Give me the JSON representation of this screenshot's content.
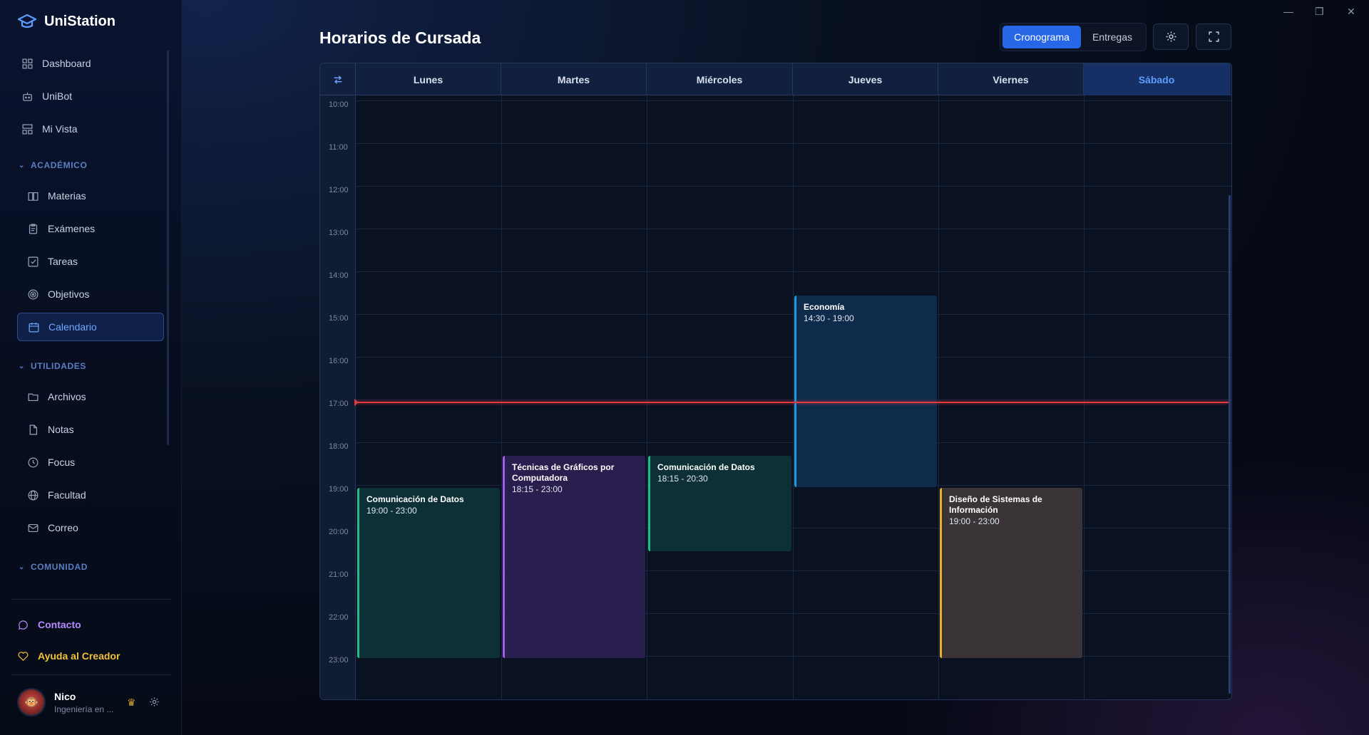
{
  "app": {
    "name": "UniStation"
  },
  "sidebar": {
    "top_items": [
      {
        "label": "Dashboard",
        "icon": "dashboard-icon"
      },
      {
        "label": "UniBot",
        "icon": "bot-icon"
      },
      {
        "label": "Mi Vista",
        "icon": "layout-icon"
      }
    ],
    "sections": {
      "academico": {
        "title": "ACADÉMICO",
        "items": [
          {
            "label": "Materias",
            "icon": "book-icon"
          },
          {
            "label": "Exámenes",
            "icon": "clipboard-icon"
          },
          {
            "label": "Tareas",
            "icon": "checkbox-icon"
          },
          {
            "label": "Objetivos",
            "icon": "target-icon"
          },
          {
            "label": "Calendario",
            "icon": "calendar-icon",
            "active": true
          }
        ]
      },
      "utilidades": {
        "title": "UTILIDADES",
        "items": [
          {
            "label": "Archivos",
            "icon": "folder-icon"
          },
          {
            "label": "Notas",
            "icon": "note-icon"
          },
          {
            "label": "Focus",
            "icon": "clock-icon"
          },
          {
            "label": "Facultad",
            "icon": "globe-icon"
          },
          {
            "label": "Correo",
            "icon": "mail-icon"
          }
        ]
      },
      "comunidad": {
        "title": "COMUNIDAD"
      }
    },
    "bottom": {
      "contact": "Contacto",
      "help": "Ayuda al Creador"
    },
    "user": {
      "name": "Nico",
      "subtitle": "Ingeniería en ..."
    }
  },
  "header": {
    "title": "Horarios de Cursada",
    "tabs": [
      "Cronograma",
      "Entregas"
    ],
    "active_tab": "Cronograma"
  },
  "calendar": {
    "days": [
      "Lunes",
      "Martes",
      "Miércoles",
      "Jueves",
      "Viernes",
      "Sábado"
    ],
    "today": "Sábado",
    "hours": [
      "10:00",
      "11:00",
      "12:00",
      "13:00",
      "14:00",
      "15:00",
      "16:00",
      "17:00",
      "18:00",
      "19:00",
      "20:00",
      "21:00",
      "22:00",
      "23:00"
    ],
    "current_time": "16:59",
    "events": [
      {
        "title": "Comunicación de Datos",
        "time": "19:00 - 23:00",
        "day": "Lunes",
        "color": "#1fbf8a"
      },
      {
        "title": "Técnicas de Gráficos por Computadora",
        "time": "18:15 - 23:00",
        "day": "Martes",
        "color": "#a25cf0"
      },
      {
        "title": "Comunicación de Datos",
        "time": "18:15 - 20:30",
        "day": "Miércoles",
        "color": "#1fbf8a"
      },
      {
        "title": "Economía",
        "time": "14:30 - 19:00",
        "day": "Jueves",
        "color": "#1c9be0"
      },
      {
        "title": "Diseño de Sistemas de Información",
        "time": "19:00 - 23:00",
        "day": "Viernes",
        "color": "#e4b12a"
      }
    ]
  },
  "colors": {
    "accent": "#2866e8",
    "now_line": "#e0393e"
  }
}
